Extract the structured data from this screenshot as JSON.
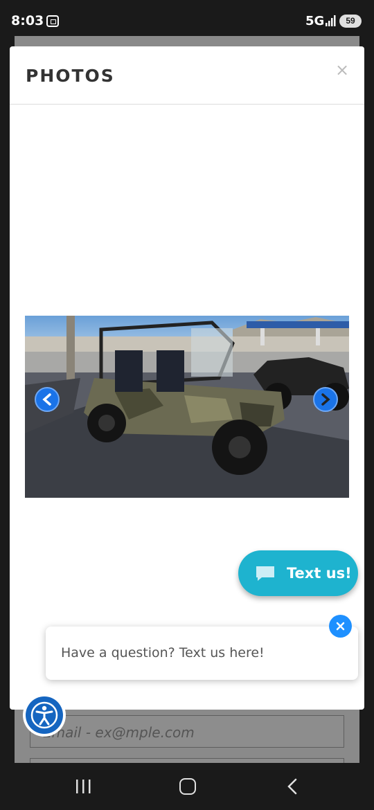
{
  "status_bar": {
    "time": "8:03",
    "network": "5G",
    "battery": "59"
  },
  "modal": {
    "title": "PHOTOS",
    "close_glyph": "×"
  },
  "photo": {
    "subject": "side-by-side utility vehicle in camo parked on street"
  },
  "carousel": {
    "prev_glyph": "‹",
    "next_glyph": "›"
  },
  "text_us": {
    "label": "Text us!",
    "bubble_text": "Have a question? Text us here!"
  },
  "background_page": {
    "email_placeholder": "Email - ex@mple.com"
  },
  "colors": {
    "text_us_bg": "#1eb3cf",
    "carousel_btn": "#1a73e8",
    "accessibility": "#1565c0"
  },
  "icons": [
    "screen-record-icon",
    "signal-icon",
    "message-icon",
    "close-icon",
    "accessibility-icon",
    "nav-recents-icon",
    "nav-home-icon",
    "nav-back-icon"
  ]
}
